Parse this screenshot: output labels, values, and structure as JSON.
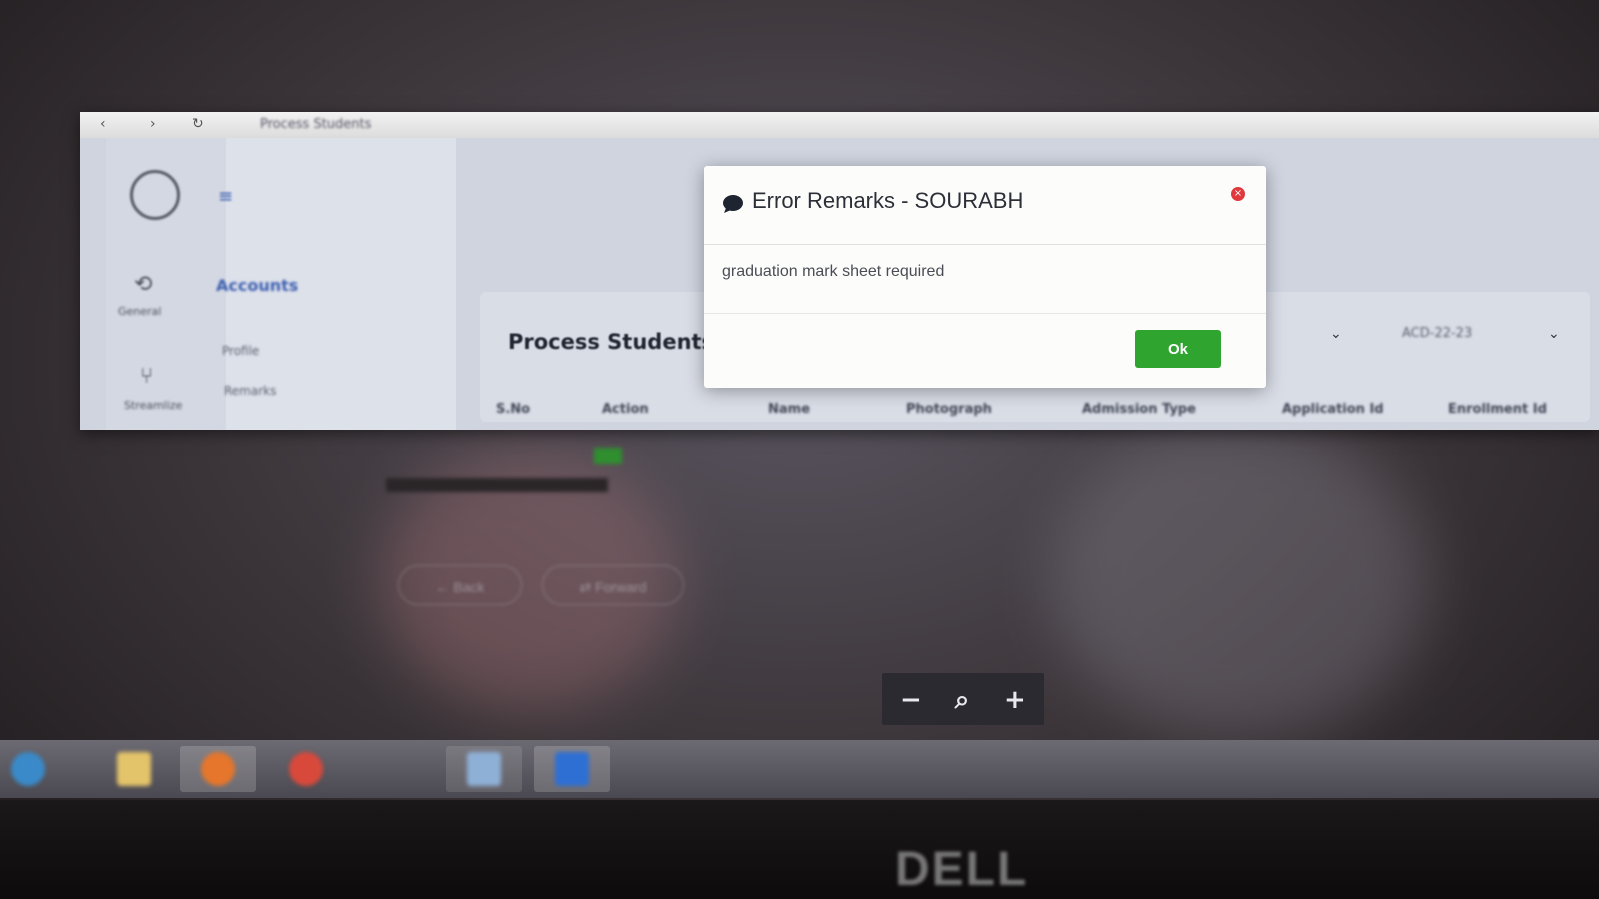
{
  "browser": {
    "nav_back": "‹",
    "nav_forward": "›",
    "nav_reload": "↻",
    "url": "Process Students"
  },
  "sidebar": {
    "hamburger": "≡",
    "items": [
      {
        "label": "General",
        "icon": "refresh-icon"
      },
      {
        "label": "Streamlize",
        "icon": "branch-icon"
      }
    ]
  },
  "side_menu": {
    "heading": "Accounts",
    "subitems": [
      "Profile",
      "Remarks"
    ]
  },
  "main": {
    "title": "Process Students",
    "filters": [
      {
        "value": ""
      },
      {
        "value": "ACD-22-23"
      }
    ],
    "table_headers": [
      "S.No",
      "Action",
      "Name",
      "Photograph",
      "Admission Type",
      "Application Id",
      "Enrollment Id"
    ]
  },
  "pager": {
    "back_label": "← Back",
    "forward_label": "⇄ Forward"
  },
  "modal": {
    "title": "Error Remarks - SOURABH",
    "message": "graduation mark sheet required",
    "ok_label": "Ok",
    "close_icon": "×",
    "accent_color": "#2fa52f",
    "close_color": "#e0383c"
  },
  "zoom_control": {
    "minus": "−",
    "zoom": "⌕",
    "plus": "+"
  },
  "taskbar": {
    "items": [
      {
        "name": "start-button",
        "color": "#3a8ac9"
      },
      {
        "name": "file-explorer",
        "color": "#e4c46a"
      },
      {
        "name": "firefox",
        "color": "#e5762b"
      },
      {
        "name": "chrome",
        "color": "#d9493b"
      },
      {
        "name": "photos",
        "color": "#8fb0d6"
      },
      {
        "name": "word",
        "color": "#2e6fd4"
      }
    ]
  },
  "bezel": {
    "brand": "DELL"
  }
}
